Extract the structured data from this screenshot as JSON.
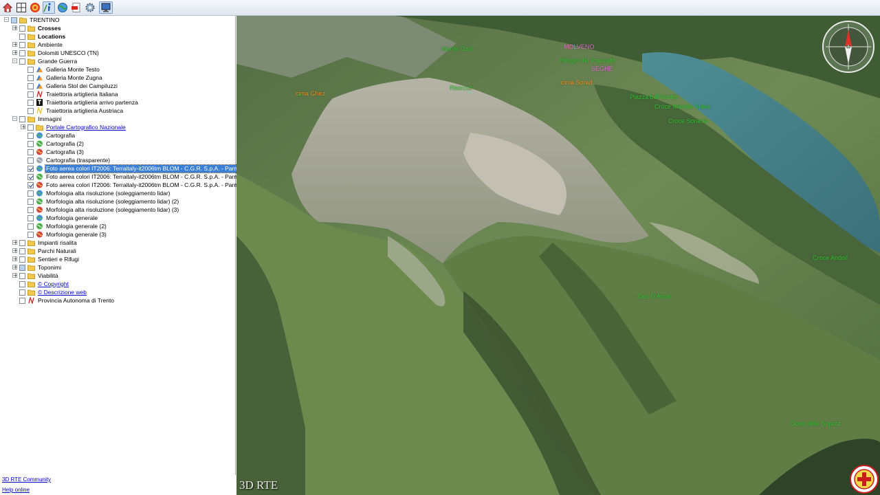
{
  "toolbar": {
    "buttons": [
      {
        "name": "home-button",
        "icon": "home-icon"
      },
      {
        "name": "grid-button",
        "icon": "grid-icon"
      },
      {
        "name": "target-button",
        "icon": "target-icon"
      },
      {
        "name": "info-button",
        "icon": "info-icon",
        "active": true
      },
      {
        "name": "globe-button",
        "icon": "globe-icon"
      },
      {
        "name": "pdf-button",
        "icon": "pdf-icon"
      },
      {
        "name": "settings-button",
        "icon": "gear-icon"
      },
      {
        "name": "monitor-button",
        "icon": "monitor-icon",
        "active": true
      }
    ]
  },
  "tree": {
    "root": "TRENTINO",
    "items": [
      {
        "label": "Crosses",
        "bold": true
      },
      {
        "label": "Locations",
        "bold": true
      },
      {
        "label": "Ambiente"
      },
      {
        "label": "Dolomiti UNESCO (TN)"
      },
      {
        "label": "Grande Guerra"
      },
      {
        "label": "Galleria Monte Testo"
      },
      {
        "label": "Galleria Monte Zugna"
      },
      {
        "label": "Galleria Stol dei Campiluzzi"
      },
      {
        "label": "Traiettoria artiglieria Italiana"
      },
      {
        "label": "Traiettoria artiglieria arrivo partenza"
      },
      {
        "label": "Traiettoria artiglieria Austriaca"
      },
      {
        "label": "Immagini"
      },
      {
        "label": "Portale Cartografico Nazionale"
      },
      {
        "label": "Cartografia"
      },
      {
        "label": "Cartografia (2)"
      },
      {
        "label": "Cartografia (3)"
      },
      {
        "label": "Cartografia (trasparente)"
      },
      {
        "label": "Foto aerea colori IT2006: Terraitaly-it2006tm BLOM - C.G.R. S.p.A. - Parma"
      },
      {
        "label": "Foto aerea colori IT2006: Terraitaly-it2006tm BLOM - C.G.R. S.p.A. - Parma (2)"
      },
      {
        "label": "Foto aerea colori IT2006: Terraitaly-it2006tm BLOM - C.G.R. S.p.A. - Parma (3)"
      },
      {
        "label": "Morfologia alta risoluzione (soleggiamento lidar)"
      },
      {
        "label": "Morfologia alta risoluzione (soleggiamento lidar) (2)"
      },
      {
        "label": "Morfologia alta risoluzione (soleggiamento lidar) (3)"
      },
      {
        "label": "Morfologia generale"
      },
      {
        "label": "Morfologia generale (2)"
      },
      {
        "label": "Morfologia generale (3)"
      },
      {
        "label": "Impianti risalita"
      },
      {
        "label": "Parchi Naturali"
      },
      {
        "label": "Sentieri e Rifugi"
      },
      {
        "label": "Toponimi"
      },
      {
        "label": "Viabilità"
      },
      {
        "label": "© Copyright"
      },
      {
        "label": "© Descrizione web"
      },
      {
        "label": "Provincia Autonoma di Trento"
      }
    ]
  },
  "bottom_links": {
    "community": "3D RTE Community",
    "help": "Help online"
  },
  "map": {
    "brand": "3D RTE",
    "labels": [
      {
        "text": "Monte Ozol",
        "color": "#2fbf2f"
      },
      {
        "text": "MOLVENO",
        "color": "#e06bd0"
      },
      {
        "text": "Rifugio del Pranzatil",
        "color": "#2fbf2f"
      },
      {
        "text": "SEGHE",
        "color": "#e06bd0"
      },
      {
        "text": "cima Sorad",
        "color": "#f08a1c"
      },
      {
        "text": "cima Ghez",
        "color": "#f08a1c"
      },
      {
        "text": "Ritorcoll",
        "color": "#2fbf2f"
      },
      {
        "text": "Piazza del Sestol",
        "color": "#2fbf2f"
      },
      {
        "text": "Croce Marella Selva",
        "color": "#2fbf2f"
      },
      {
        "text": "Croce Soracla",
        "color": "#2fbf2f"
      },
      {
        "text": "Croce Andoll",
        "color": "#2fbf2f"
      },
      {
        "text": "Dos D'Amal",
        "color": "#2fbf2f"
      },
      {
        "text": "Doss della Sprazz",
        "color": "#2fbf2f"
      }
    ]
  },
  "colors": {
    "selection": "#3a7fd8",
    "link": "#0000cc",
    "folder": "#f2c94c"
  }
}
